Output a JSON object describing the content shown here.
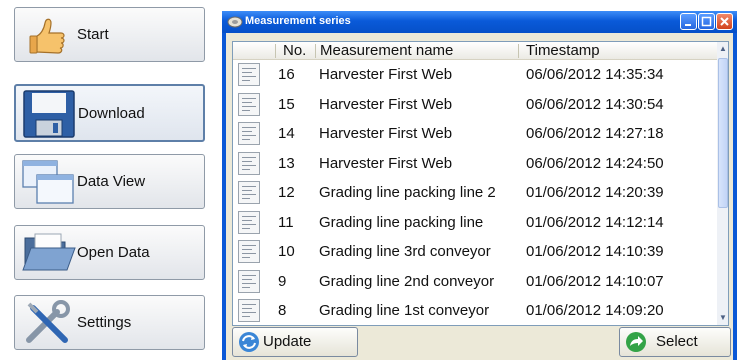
{
  "nav": {
    "items": [
      {
        "label": "Start",
        "icon": "thumbs-up-icon"
      },
      {
        "label": "Download",
        "icon": "floppy-disk-icon"
      },
      {
        "label": "Data View",
        "icon": "windows-icon"
      },
      {
        "label": "Open Data",
        "icon": "open-folder-icon"
      },
      {
        "label": "Settings",
        "icon": "tools-icon"
      }
    ],
    "active": "Download"
  },
  "window": {
    "title": "Measurement series",
    "columns": {
      "no": "No.",
      "name": "Measurement name",
      "timestamp": "Timestamp"
    },
    "rows": [
      {
        "no": "16",
        "name": "Harvester First Web",
        "timestamp": "06/06/2012 14:35:34"
      },
      {
        "no": "15",
        "name": "Harvester First Web",
        "timestamp": "06/06/2012 14:30:54"
      },
      {
        "no": "14",
        "name": "Harvester First Web",
        "timestamp": "06/06/2012 14:27:18"
      },
      {
        "no": "13",
        "name": "Harvester First Web",
        "timestamp": "06/06/2012 14:24:50"
      },
      {
        "no": "12",
        "name": "Grading line packing line 2",
        "timestamp": "01/06/2012 14:20:39"
      },
      {
        "no": "11",
        "name": "Grading line packing line",
        "timestamp": "01/06/2012 14:12:14"
      },
      {
        "no": "10",
        "name": "Grading line 3rd conveyor",
        "timestamp": "01/06/2012 14:10:39"
      },
      {
        "no": "9",
        "name": "Grading line 2nd conveyor",
        "timestamp": "01/06/2012 14:10:07"
      },
      {
        "no": "8",
        "name": "Grading line 1st conveyor",
        "timestamp": "01/06/2012 14:09:20"
      }
    ],
    "update_label": "Update",
    "select_label": "Select"
  },
  "colors": {
    "titlebar": "#0a58d6",
    "client": "#ece9d8",
    "accent": "#5e7fa8"
  }
}
